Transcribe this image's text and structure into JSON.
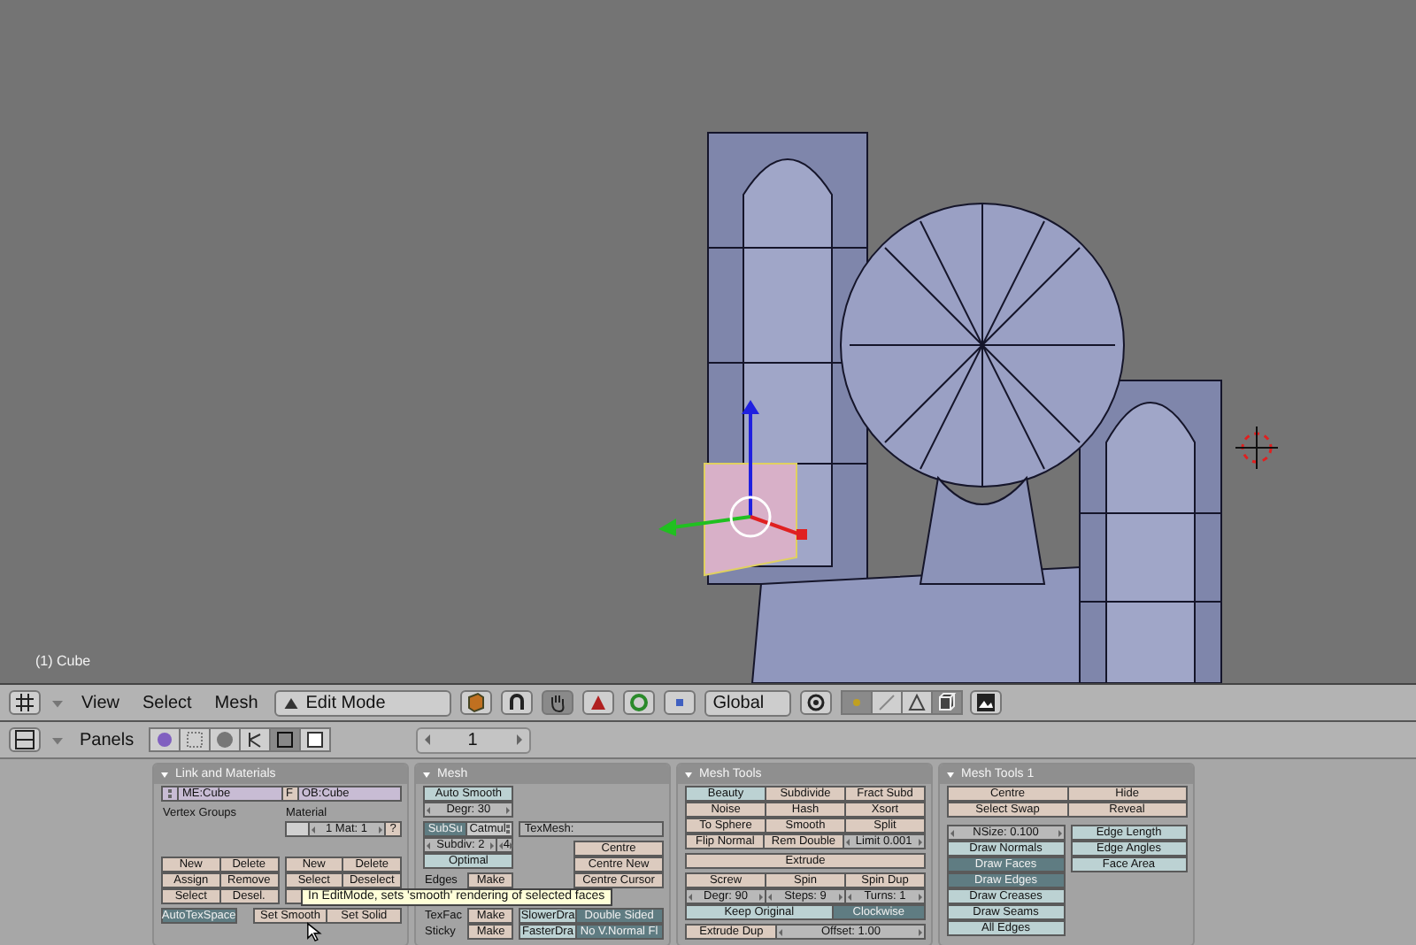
{
  "viewport": {
    "object_label": "(1) Cube"
  },
  "header": {
    "menus": [
      "View",
      "Select",
      "Mesh"
    ],
    "mode": "Edit Mode",
    "orientation": "Global",
    "select_modes": [
      {
        "selected": true
      },
      {
        "selected": false
      },
      {
        "selected": false
      }
    ],
    "occlude": {
      "on": true
    }
  },
  "panels_header": {
    "label": "Panels",
    "context_tabs": [
      {
        "selected": false
      },
      {
        "selected": false
      },
      {
        "selected": false
      },
      {
        "selected": false
      },
      {
        "selected": true
      },
      {
        "selected": false
      }
    ],
    "frame": "1"
  },
  "panels": [
    {
      "title": "Link and Materials",
      "blocks": [
        {
          "kind": "row",
          "items": [
            {
              "kind": "browse"
            },
            {
              "kind": "datablock",
              "text": "ME:Cube"
            },
            {
              "kind": "action_small",
              "text": "F"
            },
            {
              "kind": "datablock",
              "text": "OB:Cube"
            }
          ]
        },
        {
          "kind": "gap"
        },
        {
          "kind": "split",
          "cols": [
            {
              "blocks": [
                {
                  "kind": "row",
                  "items": [
                    {
                      "kind": "label",
                      "text": "Vertex Groups"
                    }
                  ]
                },
                {
                  "kind": "skip"
                },
                {
                  "kind": "skip"
                },
                {
                  "kind": "gap"
                },
                {
                  "kind": "row",
                  "items": [
                    {
                      "kind": "action",
                      "text": "New"
                    },
                    {
                      "kind": "action",
                      "text": "Delete"
                    }
                  ]
                },
                {
                  "kind": "row",
                  "items": [
                    {
                      "kind": "action",
                      "text": "Assign"
                    },
                    {
                      "kind": "action",
                      "text": "Remove"
                    }
                  ]
                },
                {
                  "kind": "row",
                  "items": [
                    {
                      "kind": "action",
                      "text": "Select"
                    },
                    {
                      "kind": "action",
                      "text": "Desel."
                    }
                  ]
                }
              ]
            },
            {
              "blocks": [
                {
                  "kind": "row",
                  "items": [
                    {
                      "kind": "label",
                      "text": "Material"
                    }
                  ]
                },
                {
                  "kind": "row",
                  "items": [
                    {
                      "kind": "swatch"
                    },
                    {
                      "kind": "num_wide",
                      "text": "1 Mat: 1"
                    },
                    {
                      "kind": "action_small",
                      "text": "?"
                    }
                  ]
                },
                {
                  "kind": "skip"
                },
                {
                  "kind": "gap"
                },
                {
                  "kind": "row",
                  "items": [
                    {
                      "kind": "action",
                      "text": "New"
                    },
                    {
                      "kind": "action",
                      "text": "Delete"
                    }
                  ]
                },
                {
                  "kind": "row",
                  "items": [
                    {
                      "kind": "action",
                      "text": "Select"
                    },
                    {
                      "kind": "action",
                      "text": "Deselect"
                    }
                  ]
                },
                {
                  "kind": "row",
                  "items": [
                    {
                      "kind": "covered"
                    }
                  ]
                }
              ]
            }
          ]
        },
        {
          "kind": "gap"
        },
        {
          "kind": "row",
          "items": [
            {
              "kind": "toggle",
              "text": "AutoTexSpace",
              "on": true
            },
            {
              "kind": "blank_small"
            },
            {
              "kind": "action",
              "text": "Set Smooth"
            },
            {
              "kind": "action",
              "text": "Set Solid"
            }
          ]
        }
      ]
    },
    {
      "title": "Mesh",
      "blocks": [
        {
          "kind": "split_wideright",
          "cols": [
            {
              "blocks": [
                {
                  "kind": "row",
                  "items": [
                    {
                      "kind": "toggle",
                      "text": "Auto Smooth",
                      "on": false
                    }
                  ]
                },
                {
                  "kind": "row",
                  "items": [
                    {
                      "kind": "num",
                      "text": "Degr: 30"
                    }
                  ]
                },
                {
                  "kind": "gap"
                },
                {
                  "kind": "row",
                  "items": [
                    {
                      "kind": "toggle",
                      "text": "SubSu",
                      "on": true
                    },
                    {
                      "kind": "menu",
                      "text": "Catmul"
                    }
                  ]
                },
                {
                  "kind": "row",
                  "items": [
                    {
                      "kind": "num_wide",
                      "text": "Subdiv: 2"
                    },
                    {
                      "kind": "num_small",
                      "text": "4"
                    }
                  ]
                },
                {
                  "kind": "row",
                  "items": [
                    {
                      "kind": "toggle",
                      "text": "Optimal",
                      "on": false
                    }
                  ]
                },
                {
                  "kind": "gap"
                },
                {
                  "kind": "row",
                  "items": [
                    {
                      "kind": "label",
                      "text": "Edges"
                    },
                    {
                      "kind": "action",
                      "text": "Make"
                    }
                  ]
                },
                {
                  "kind": "row",
                  "items": [
                    {
                      "kind": "covered"
                    }
                  ]
                },
                {
                  "kind": "gap"
                },
                {
                  "kind": "row",
                  "items": [
                    {
                      "kind": "label",
                      "text": "TexFac"
                    },
                    {
                      "kind": "action",
                      "text": "Make"
                    }
                  ]
                },
                {
                  "kind": "row",
                  "items": [
                    {
                      "kind": "label",
                      "text": "Sticky"
                    },
                    {
                      "kind": "action",
                      "text": "Make"
                    }
                  ]
                }
              ]
            },
            {
              "blocks": [
                {
                  "kind": "skip"
                },
                {
                  "kind": "skip"
                },
                {
                  "kind": "gap"
                },
                {
                  "kind": "row",
                  "items": [
                    {
                      "kind": "field",
                      "text": "TexMesh:"
                    }
                  ]
                },
                {
                  "kind": "gap"
                },
                {
                  "kind": "row",
                  "items": [
                    {
                      "kind": "blank"
                    },
                    {
                      "kind": "action_wide",
                      "text": "Centre"
                    }
                  ]
                },
                {
                  "kind": "row",
                  "items": [
                    {
                      "kind": "blank"
                    },
                    {
                      "kind": "action_wide",
                      "text": "Centre New"
                    }
                  ]
                },
                {
                  "kind": "row",
                  "items": [
                    {
                      "kind": "blank"
                    },
                    {
                      "kind": "action_wide",
                      "text": "Centre Cursor"
                    }
                  ]
                },
                {
                  "kind": "skip"
                },
                {
                  "kind": "gap"
                },
                {
                  "kind": "row",
                  "items": [
                    {
                      "kind": "toggle",
                      "text": "SlowerDra",
                      "on": false
                    },
                    {
                      "kind": "toggle_wide",
                      "text": "Double Sided",
                      "on": true
                    }
                  ]
                },
                {
                  "kind": "row",
                  "items": [
                    {
                      "kind": "toggle",
                      "text": "FasterDra",
                      "on": false
                    },
                    {
                      "kind": "toggle_wide",
                      "text": "No V.Normal Fl",
                      "on": true
                    }
                  ]
                }
              ]
            }
          ]
        }
      ]
    },
    {
      "title": "Mesh Tools",
      "blocks": [
        {
          "kind": "row",
          "items": [
            {
              "kind": "toggle",
              "text": "Beauty",
              "on": false
            },
            {
              "kind": "action",
              "text": "Subdivide"
            },
            {
              "kind": "action",
              "text": "Fract Subd"
            }
          ]
        },
        {
          "kind": "row",
          "items": [
            {
              "kind": "action",
              "text": "Noise"
            },
            {
              "kind": "action",
              "text": "Hash"
            },
            {
              "kind": "action",
              "text": "Xsort"
            }
          ]
        },
        {
          "kind": "row",
          "items": [
            {
              "kind": "action",
              "text": "To Sphere"
            },
            {
              "kind": "action",
              "text": "Smooth"
            },
            {
              "kind": "action",
              "text": "Split"
            }
          ]
        },
        {
          "kind": "row",
          "items": [
            {
              "kind": "action",
              "text": "Flip Normal"
            },
            {
              "kind": "action",
              "text": "Rem Double"
            },
            {
              "kind": "num",
              "text": "Limit 0.001"
            }
          ]
        },
        {
          "kind": "gap"
        },
        {
          "kind": "row",
          "items": [
            {
              "kind": "action",
              "text": "Extrude"
            }
          ]
        },
        {
          "kind": "gap"
        },
        {
          "kind": "row",
          "items": [
            {
              "kind": "action",
              "text": "Screw"
            },
            {
              "kind": "action",
              "text": "Spin"
            },
            {
              "kind": "action",
              "text": "Spin Dup"
            }
          ]
        },
        {
          "kind": "row",
          "items": [
            {
              "kind": "num",
              "text": "Degr: 90"
            },
            {
              "kind": "num",
              "text": "Steps: 9"
            },
            {
              "kind": "num",
              "text": "Turns: 1"
            }
          ]
        },
        {
          "kind": "row",
          "items": [
            {
              "kind": "toggle_wide",
              "text": "Keep Original",
              "on": false
            },
            {
              "kind": "toggle",
              "text": "Clockwise",
              "on": true
            }
          ]
        },
        {
          "kind": "gap"
        },
        {
          "kind": "row",
          "items": [
            {
              "kind": "action",
              "text": "Extrude Dup"
            },
            {
              "kind": "num_wide",
              "text": "Offset: 1.00"
            }
          ]
        }
      ]
    },
    {
      "title": "Mesh Tools 1",
      "blocks": [
        {
          "kind": "row",
          "items": [
            {
              "kind": "action",
              "text": "Centre"
            },
            {
              "kind": "action",
              "text": "Hide"
            }
          ]
        },
        {
          "kind": "row",
          "items": [
            {
              "kind": "action",
              "text": "Select Swap"
            },
            {
              "kind": "action",
              "text": "Reveal"
            }
          ]
        },
        {
          "kind": "gap"
        },
        {
          "kind": "gap"
        },
        {
          "kind": "split",
          "cols": [
            {
              "blocks": [
                {
                  "kind": "row",
                  "items": [
                    {
                      "kind": "num",
                      "text": "NSize: 0.100"
                    }
                  ]
                },
                {
                  "kind": "row",
                  "items": [
                    {
                      "kind": "toggle",
                      "text": "Draw Normals",
                      "on": false
                    }
                  ]
                },
                {
                  "kind": "row",
                  "items": [
                    {
                      "kind": "toggle",
                      "text": "Draw Faces",
                      "on": true
                    }
                  ]
                },
                {
                  "kind": "row",
                  "items": [
                    {
                      "kind": "toggle",
                      "text": "Draw Edges",
                      "on": true
                    }
                  ]
                },
                {
                  "kind": "row",
                  "items": [
                    {
                      "kind": "toggle",
                      "text": "Draw Creases",
                      "on": false
                    }
                  ]
                },
                {
                  "kind": "row",
                  "items": [
                    {
                      "kind": "toggle",
                      "text": "Draw Seams",
                      "on": false
                    }
                  ]
                },
                {
                  "kind": "row",
                  "items": [
                    {
                      "kind": "toggle",
                      "text": "All Edges",
                      "on": false
                    }
                  ]
                }
              ]
            },
            {
              "blocks": [
                {
                  "kind": "row",
                  "items": [
                    {
                      "kind": "toggle",
                      "text": "Edge Length",
                      "on": false
                    }
                  ]
                },
                {
                  "kind": "row",
                  "items": [
                    {
                      "kind": "toggle",
                      "text": "Edge Angles",
                      "on": false
                    }
                  ]
                },
                {
                  "kind": "row",
                  "items": [
                    {
                      "kind": "toggle",
                      "text": "Face Area",
                      "on": false
                    }
                  ]
                }
              ]
            }
          ]
        }
      ]
    }
  ],
  "tooltip": {
    "text": "In EditMode, sets 'smooth' rendering of selected faces"
  }
}
